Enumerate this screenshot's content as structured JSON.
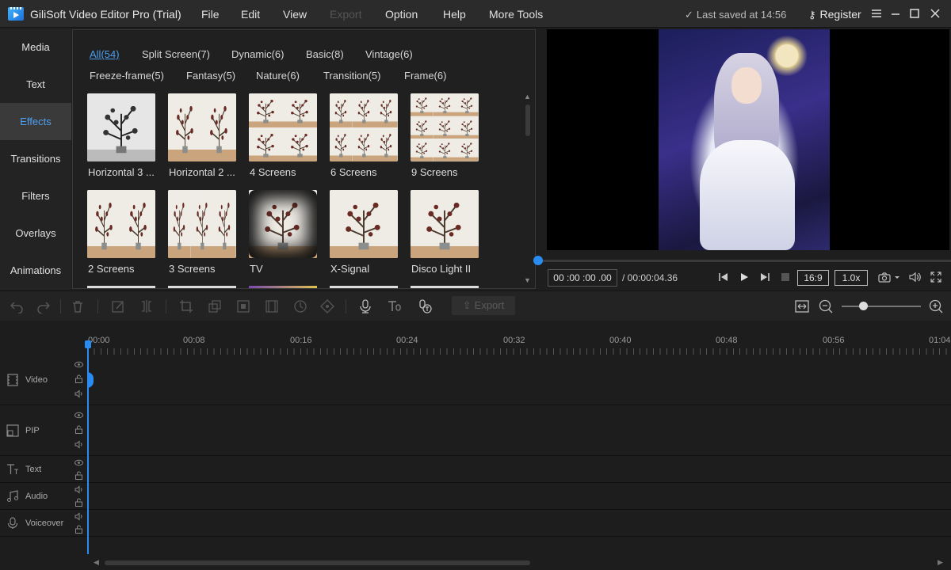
{
  "titlebar": {
    "title": "GiliSoft Video Editor Pro (Trial)",
    "menu": [
      "File",
      "Edit",
      "View",
      "Export",
      "Option",
      "Help",
      "More Tools"
    ],
    "last_saved": "Last saved at 14:56",
    "register": "Register"
  },
  "leftnav": {
    "items": [
      "Media",
      "Text",
      "Effects",
      "Transitions",
      "Filters",
      "Overlays",
      "Animations"
    ],
    "active": "Effects"
  },
  "effects": {
    "categories_row1": [
      "All(54)",
      "Split Screen(7)",
      "Dynamic(6)",
      "Basic(8)",
      "Vintage(6)"
    ],
    "categories_row2": [
      "Freeze-frame(5)",
      "Fantasy(5)",
      "Nature(6)",
      "Transition(5)",
      "Frame(6)"
    ],
    "active_category": "All(54)",
    "row1": [
      "Horizontal 3 ...",
      "Horizontal 2 ...",
      "4 Screens",
      "6 Screens",
      "9 Screens"
    ],
    "row2": [
      "2 Screens",
      "3 Screens",
      "TV",
      "X-Signal",
      "Disco Light II"
    ]
  },
  "player": {
    "current_time": "00 :00 :00 .00",
    "total_time": "/ 00:00:04.36",
    "aspect": "16:9",
    "speed": "1.0x",
    "progress": 0
  },
  "toolbar": {
    "export_label": "Export"
  },
  "timeline": {
    "ticks": [
      "00:00",
      "00:08",
      "00:16",
      "00:24",
      "00:32",
      "00:40",
      "00:48",
      "00:56",
      "01:04"
    ],
    "tracks": [
      "Video",
      "PIP",
      "Text",
      "Audio",
      "Voiceover"
    ]
  },
  "colors": {
    "accent": "#2a8cf0",
    "active_nav_text": "#4ea0f0"
  }
}
